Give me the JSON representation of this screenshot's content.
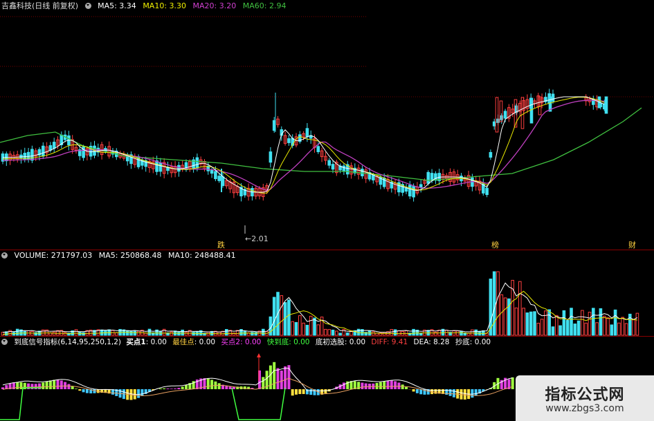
{
  "main_header": {
    "title": "吉鑫科技(日线 前复权)",
    "ma5": "MA5: 3.34",
    "ma10": "MA10: 3.30",
    "ma20": "MA20: 3.20",
    "ma60": "MA60: 2.94"
  },
  "volume_header": {
    "volume": "VOLUME: 271797.03",
    "ma5": "MA5: 250868.48",
    "ma10": "MA10: 248488.41"
  },
  "indicator_header": {
    "name": "到底信号指标(6,14,95,250,1,2)",
    "buy1_label": "买点1",
    "buy1_value": ": 0.00",
    "best_label": "最佳点",
    "best_value": ": 0.00",
    "buy2_label": "买点2",
    "buy2_value": ": 0.00",
    "near_bottom_label": "快到底",
    "near_bottom_value": ": 0.00",
    "initial_label": "底初选股",
    "initial_value": ": 0.00",
    "diff_label": "DIFF",
    "diff_value": ": 9.41",
    "dea": "DEA: 8.28",
    "chaodi": "抄底: 0.00"
  },
  "annotations": {
    "low_price": "←2.01",
    "mark_drop": "跌",
    "mark_list": "榜",
    "mark_fin": "财"
  },
  "watermark": {
    "title": "指标公式网",
    "url": "www.zbgs3.com"
  },
  "colors": {
    "background": "#000000",
    "ma5": "#ffffff",
    "ma10": "#f0f000",
    "ma20": "#d040d0",
    "ma60": "#40c040",
    "up": "#ff4040",
    "down": "#40e0f0",
    "separator": "#8a0000"
  }
}
